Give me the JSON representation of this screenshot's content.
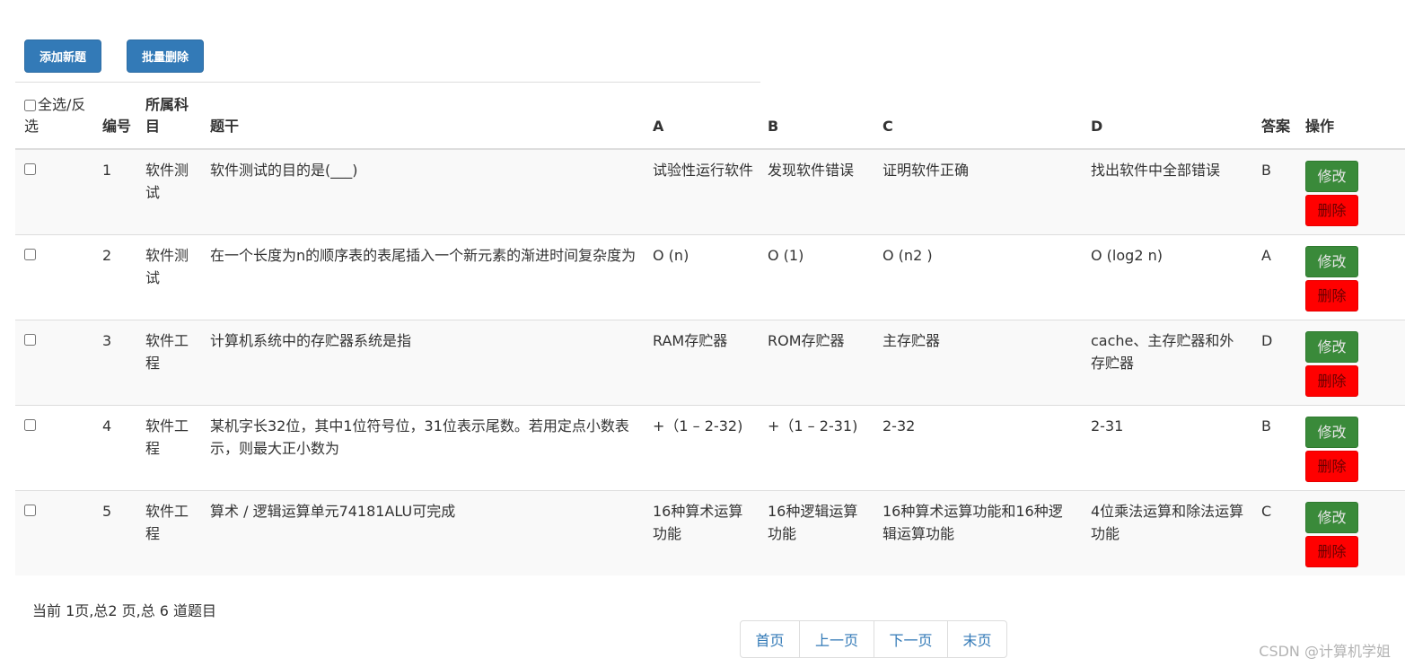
{
  "toolbar": {
    "add_label": "添加新题",
    "batch_delete_label": "批量删除"
  },
  "table": {
    "headers": {
      "select_all": "全选/反选",
      "id": "编号",
      "subject": "所属科目",
      "stem": "题干",
      "a": "A",
      "b": "B",
      "c": "C",
      "d": "D",
      "answer": "答案",
      "action": "操作"
    },
    "rows": [
      {
        "id": "1",
        "subject": "软件测试",
        "stem": "软件测试的目的是(___)",
        "a": "试验性运行软件",
        "b": "发现软件错误",
        "c": "证明软件正确",
        "d": "找出软件中全部错误",
        "answer": "B",
        "edit": "修改",
        "delete": "删除"
      },
      {
        "id": "2",
        "subject": "软件测试",
        "stem": "在一个长度为n的顺序表的表尾插入一个新元素的渐进时间复杂度为",
        "a": "O (n)",
        "b": "O (1)",
        "c": "O (n2 )",
        "d": "O (log2 n)",
        "answer": "A",
        "edit": "修改",
        "delete": "删除"
      },
      {
        "id": "3",
        "subject": "软件工程",
        "stem": "计算机系统中的存贮器系统是指",
        "a": "RAM存贮器",
        "b": "ROM存贮器",
        "c": "主存贮器",
        "d": "cache、主存贮器和外存贮器",
        "answer": "D",
        "edit": "修改",
        "delete": "删除"
      },
      {
        "id": "4",
        "subject": "软件工程",
        "stem": "某机字长32位，其中1位符号位，31位表示尾数。若用定点小数表示，则最大正小数为",
        "a": "+（1 – 2-32)",
        "b": "+（1 – 2-31)",
        "c": "2-32",
        "d": "2-31",
        "answer": "B",
        "edit": "修改",
        "delete": "删除"
      },
      {
        "id": "5",
        "subject": "软件工程",
        "stem": "算术 / 逻辑运算单元74181ALU可完成",
        "a": "16种算术运算功能",
        "b": "16种逻辑运算功能",
        "c": "16种算术运算功能和16种逻辑运算功能",
        "d": "4位乘法运算和除法运算功能",
        "answer": "C",
        "edit": "修改",
        "delete": "删除"
      }
    ]
  },
  "status_text": "当前 1页,总2 页,总 6 道题目",
  "pagination": {
    "first": "首页",
    "prev": "上一页",
    "next": "下一页",
    "last": "末页"
  },
  "watermark": "CSDN @计算机学姐"
}
